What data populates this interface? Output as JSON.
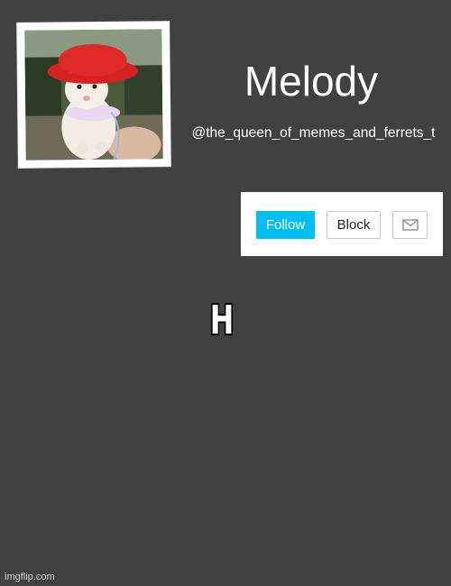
{
  "profile": {
    "display_name": "Melody",
    "handle": "@the_queen_of_memes_and_ferrets_t"
  },
  "actions": {
    "follow_label": "Follow",
    "block_label": "Block",
    "message_icon": "envelope-icon"
  },
  "post": {
    "text": "H"
  },
  "watermark": "imgflip.com",
  "colors": {
    "background": "#414141",
    "follow_button": "#00bdf2",
    "panel": "#ffffff"
  }
}
